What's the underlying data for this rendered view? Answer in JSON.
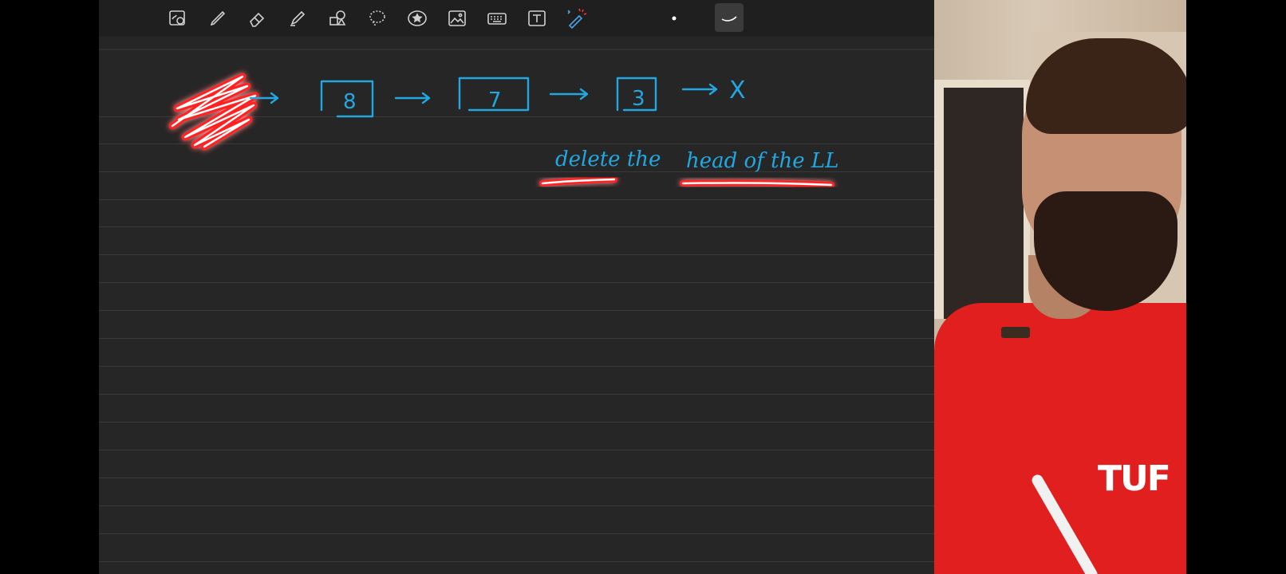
{
  "toolbar": {
    "tools": [
      {
        "name": "zoom-image-icon"
      },
      {
        "name": "pen-icon"
      },
      {
        "name": "eraser-icon"
      },
      {
        "name": "highlighter-icon"
      },
      {
        "name": "shapes-icon"
      },
      {
        "name": "lasso-icon"
      },
      {
        "name": "sticker-icon"
      },
      {
        "name": "image-icon"
      },
      {
        "name": "keyboard-icon"
      },
      {
        "name": "text-box-icon"
      },
      {
        "name": "laser-pointer-icon"
      },
      {
        "name": "stroke-dot-icon"
      },
      {
        "name": "stroke-curve-icon"
      }
    ],
    "active_tool": "stroke-curve-icon"
  },
  "notes": {
    "list_values": [
      "8",
      "7",
      "3"
    ],
    "null_label": "X",
    "caption_left": "delete the",
    "caption_right": "head of the LL",
    "ink_color": "#22a7e0",
    "highlight_color": "#ff1a1a"
  },
  "video": {
    "shirt_logo": "TUF"
  }
}
